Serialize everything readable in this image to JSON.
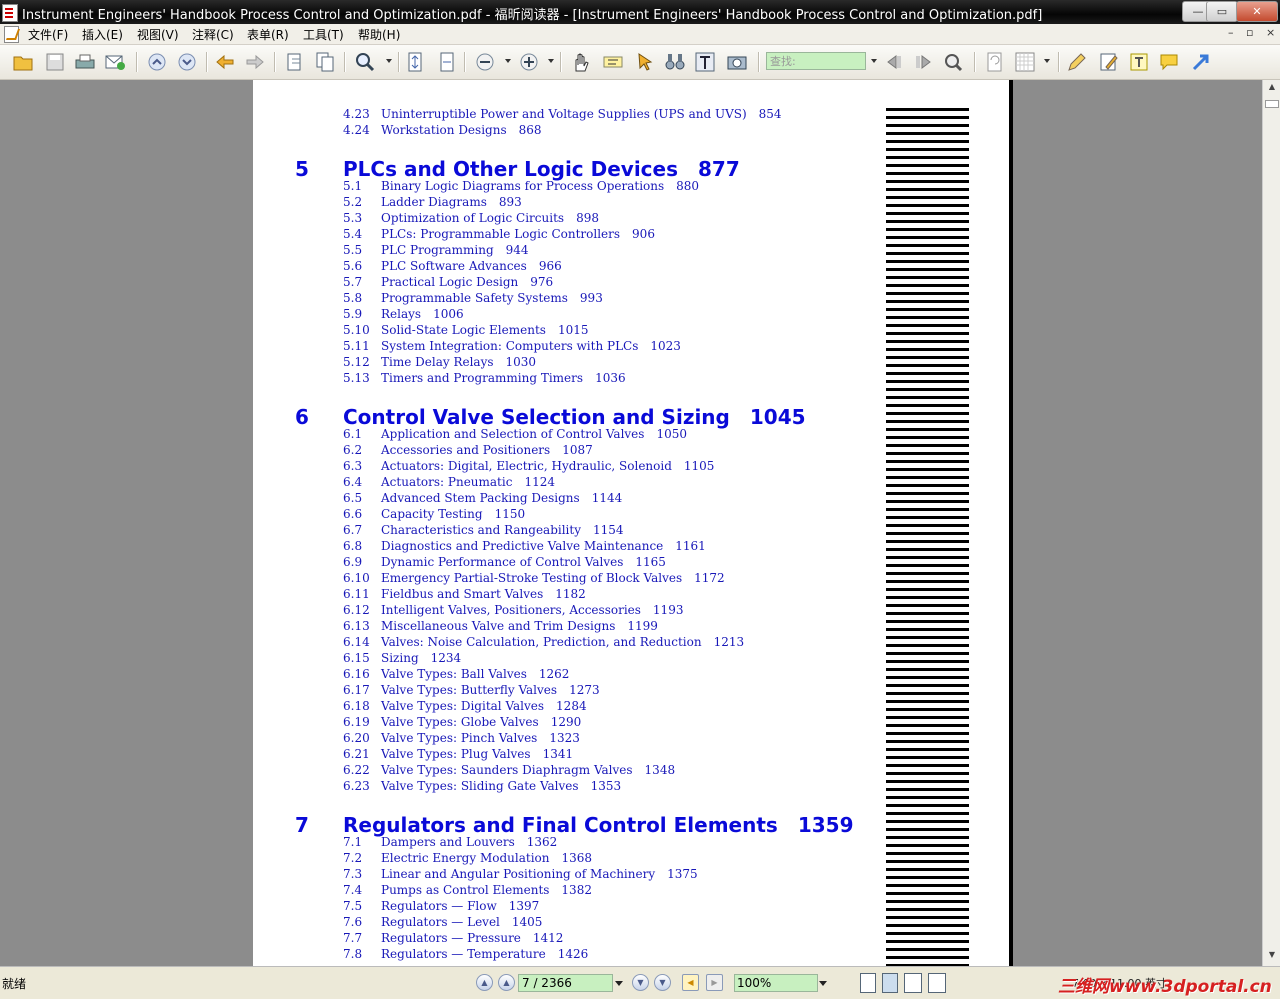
{
  "window": {
    "title": "Instrument Engineers' Handbook Process Control and Optimization.pdf - 福昕阅读器 - [Instrument Engineers' Handbook Process Control and Optimization.pdf]",
    "minimize": "—",
    "restore": "▭",
    "close": "✕"
  },
  "menu": {
    "items": [
      "文件(F)",
      "插入(E)",
      "视图(V)",
      "注释(C)",
      "表单(R)",
      "工具(T)",
      "帮助(H)"
    ],
    "mdi_min": "–",
    "mdi_restore": "▫",
    "mdi_close": "×"
  },
  "toolbar": {
    "find_placeholder": "查找:"
  },
  "toc": {
    "chapters": [
      {
        "number": "5",
        "title": "PLCs and Other Logic Devices",
        "page": "877"
      },
      {
        "number": "6",
        "title": "Control Valve Selection and Sizing",
        "page": "1045"
      },
      {
        "number": "7",
        "title": "Regulators and Final Control Elements",
        "page": "1359"
      }
    ],
    "entries_top": [
      {
        "num": "4.23",
        "title": "Uninterruptible Power and Voltage Supplies (UPS and UVS)",
        "page": "854"
      },
      {
        "num": "4.24",
        "title": "Workstation Designs",
        "page": "868"
      }
    ],
    "entries_ch5": [
      {
        "num": "5.1",
        "title": "Binary Logic Diagrams for Process Operations",
        "page": "880"
      },
      {
        "num": "5.2",
        "title": "Ladder Diagrams",
        "page": "893"
      },
      {
        "num": "5.3",
        "title": "Optimization of Logic Circuits",
        "page": "898"
      },
      {
        "num": "5.4",
        "title": "PLCs: Programmable Logic Controllers",
        "page": "906"
      },
      {
        "num": "5.5",
        "title": "PLC Programming",
        "page": "944"
      },
      {
        "num": "5.6",
        "title": "PLC Software Advances",
        "page": "966"
      },
      {
        "num": "5.7",
        "title": "Practical Logic Design",
        "page": "976"
      },
      {
        "num": "5.8",
        "title": "Programmable Safety Systems",
        "page": "993"
      },
      {
        "num": "5.9",
        "title": "Relays",
        "page": "1006"
      },
      {
        "num": "5.10",
        "title": "Solid-State Logic Elements",
        "page": "1015"
      },
      {
        "num": "5.11",
        "title": "System Integration: Computers with PLCs",
        "page": "1023"
      },
      {
        "num": "5.12",
        "title": "Time Delay Relays",
        "page": "1030"
      },
      {
        "num": "5.13",
        "title": "Timers and Programming Timers",
        "page": "1036"
      }
    ],
    "entries_ch6": [
      {
        "num": "6.1",
        "title": "Application and Selection of Control Valves",
        "page": "1050"
      },
      {
        "num": "6.2",
        "title": "Accessories and Positioners",
        "page": "1087"
      },
      {
        "num": "6.3",
        "title": "Actuators: Digital, Electric, Hydraulic, Solenoid",
        "page": "1105"
      },
      {
        "num": "6.4",
        "title": "Actuators: Pneumatic",
        "page": "1124"
      },
      {
        "num": "6.5",
        "title": "Advanced Stem Packing Designs",
        "page": "1144"
      },
      {
        "num": "6.6",
        "title": "Capacity Testing",
        "page": "1150"
      },
      {
        "num": "6.7",
        "title": "Characteristics and Rangeability",
        "page": "1154"
      },
      {
        "num": "6.8",
        "title": "Diagnostics and Predictive Valve Maintenance",
        "page": "1161"
      },
      {
        "num": "6.9",
        "title": "Dynamic Performance of Control Valves",
        "page": "1165"
      },
      {
        "num": "6.10",
        "title": "Emergency Partial-Stroke Testing of Block Valves",
        "page": "1172"
      },
      {
        "num": "6.11",
        "title": "Fieldbus and Smart Valves",
        "page": "1182"
      },
      {
        "num": "6.12",
        "title": "Intelligent Valves, Positioners, Accessories",
        "page": "1193"
      },
      {
        "num": "6.13",
        "title": "Miscellaneous Valve and Trim Designs",
        "page": "1199"
      },
      {
        "num": "6.14",
        "title": "Valves: Noise Calculation, Prediction, and Reduction",
        "page": "1213"
      },
      {
        "num": "6.15",
        "title": "Sizing",
        "page": "1234"
      },
      {
        "num": "6.16",
        "title": "Valve Types: Ball Valves",
        "page": "1262"
      },
      {
        "num": "6.17",
        "title": "Valve Types: Butterfly Valves",
        "page": "1273"
      },
      {
        "num": "6.18",
        "title": "Valve Types: Digital Valves",
        "page": "1284"
      },
      {
        "num": "6.19",
        "title": "Valve Types: Globe Valves",
        "page": "1290"
      },
      {
        "num": "6.20",
        "title": "Valve Types: Pinch Valves",
        "page": "1323"
      },
      {
        "num": "6.21",
        "title": "Valve Types: Plug Valves",
        "page": "1341"
      },
      {
        "num": "6.22",
        "title": "Valve Types: Saunders Diaphragm Valves",
        "page": "1348"
      },
      {
        "num": "6.23",
        "title": "Valve Types: Sliding Gate Valves",
        "page": "1353"
      }
    ],
    "entries_ch7": [
      {
        "num": "7.1",
        "title": "Dampers and Louvers",
        "page": "1362"
      },
      {
        "num": "7.2",
        "title": "Electric Energy Modulation",
        "page": "1368"
      },
      {
        "num": "7.3",
        "title": "Linear and Angular Positioning of Machinery",
        "page": "1375"
      },
      {
        "num": "7.4",
        "title": "Pumps as Control Elements",
        "page": "1382"
      },
      {
        "num": "7.5",
        "title": "Regulators — Flow",
        "page": "1397"
      },
      {
        "num": "7.6",
        "title": "Regulators — Level",
        "page": "1405"
      },
      {
        "num": "7.7",
        "title": "Regulators — Pressure",
        "page": "1412"
      },
      {
        "num": "7.8",
        "title": "Regulators — Temperature",
        "page": "1426"
      }
    ]
  },
  "status": {
    "ready": "就绪",
    "page_indicator": "7 / 2366",
    "zoom": "100%",
    "size": "7.00 x 11.00 英寸",
    "watermark": "三维网www.3dportal.cn"
  }
}
